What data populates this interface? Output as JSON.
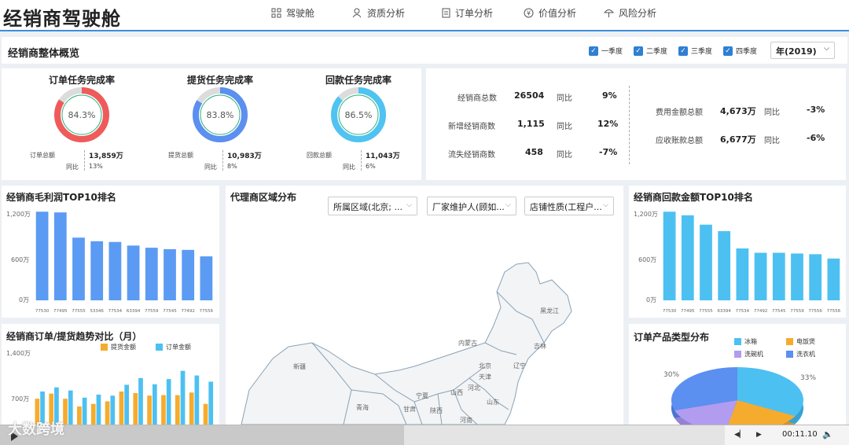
{
  "header": {
    "title": "经销商驾驶舱",
    "nav": [
      {
        "label": "驾驶舱",
        "icon": "grid-icon"
      },
      {
        "label": "资质分析",
        "icon": "people-icon"
      },
      {
        "label": "订单分析",
        "icon": "document-icon"
      },
      {
        "label": "价值分析",
        "icon": "yen-icon"
      },
      {
        "label": "风险分析",
        "icon": "umbrella-icon"
      }
    ]
  },
  "overview": {
    "title": "经销商整体概览",
    "quarters": [
      "一季度",
      "二季度",
      "三季度",
      "四季度"
    ],
    "year": "年(2019)"
  },
  "kpis": [
    {
      "title": "订单任务完成率",
      "pct": "84.3%",
      "fraction": 0.843,
      "color": "#ef5b5b",
      "amount_label": "订单总额",
      "amount": "13,859万",
      "yoy_label": "同比",
      "yoy": "13%"
    },
    {
      "title": "提货任务完成率",
      "pct": "83.8%",
      "fraction": 0.838,
      "color": "#5b8ff0",
      "amount_label": "提货总额",
      "amount": "10,983万",
      "yoy_label": "同比",
      "yoy": "8%"
    },
    {
      "title": "回款任务完成率",
      "pct": "86.5%",
      "fraction": 0.865,
      "color": "#4fc3f2",
      "amount_label": "回款总额",
      "amount": "11,043万",
      "yoy_label": "同比",
      "yoy": "6%"
    }
  ],
  "stats_left": [
    {
      "label": "经销商总数",
      "value": "26504",
      "yoy_label": "同比",
      "yoy": "9%"
    },
    {
      "label": "新增经销商数",
      "value": "1,115",
      "yoy_label": "同比",
      "yoy": "12%"
    },
    {
      "label": "流失经销商数",
      "value": "458",
      "yoy_label": "同比",
      "yoy": "-7%"
    }
  ],
  "stats_right": [
    {
      "label": "费用金额总额",
      "value": "4,673万",
      "yoy_label": "同比",
      "yoy": "-3%"
    },
    {
      "label": "应收账款总额",
      "value": "6,677万",
      "yoy_label": "同比",
      "yoy": "-6%"
    }
  ],
  "profit_chart": {
    "title": "经销商毛利润TOP10排名",
    "yticks": [
      "1,200万",
      "600万",
      "0万"
    ]
  },
  "region_map": {
    "title": "代理商区域分布",
    "filters": [
      "所属区域(北京; ...",
      "厂家维护人(顾如...",
      "店铺性质(工程户..."
    ],
    "labels": [
      "黑龙江",
      "吉林",
      "内蒙古",
      "辽宁",
      "新疆",
      "北京",
      "天津",
      "河北",
      "山西",
      "宁夏",
      "甘肃",
      "青海",
      "陕西",
      "山东",
      "河南"
    ]
  },
  "payment_chart": {
    "title": "经销商回款金额TOP10排名",
    "yticks": [
      "1,200万",
      "600万",
      "0万"
    ]
  },
  "trend_chart": {
    "title": "经销商订单/提货趋势对比（月）",
    "yticks": [
      "1,400万",
      "700万"
    ]
  },
  "pie_chart": {
    "title": "订单产品类型分布",
    "legend": [
      "冰箱",
      "电饭煲",
      "洗碗机",
      "洗衣机"
    ],
    "labels": [
      "30%",
      "33%"
    ]
  },
  "player": {
    "time": "00:11.10"
  },
  "watermark": "大数跨境",
  "colors": {
    "accent": "#3c8ee0",
    "bar_blue": "#5b9bf3",
    "bar_cyan": "#4dc0f2",
    "bar_orange": "#f5ac2e"
  },
  "chart_data": [
    {
      "type": "bar",
      "title": "经销商毛利润TOP10排名",
      "categories": [
        "77530",
        "77495",
        "77555",
        "53346",
        "77534",
        "63394",
        "77559",
        "77545",
        "77492",
        "77556"
      ],
      "values": [
        1230,
        1220,
        870,
        820,
        810,
        760,
        730,
        710,
        700,
        610
      ],
      "ylim": [
        0,
        1200
      ],
      "yunit": "万"
    },
    {
      "type": "bar",
      "title": "经销商回款金额TOP10排名",
      "categories": [
        "77530",
        "77495",
        "77555",
        "63394",
        "77534",
        "77492",
        "77545",
        "77559",
        "77556",
        "77556"
      ],
      "values": [
        1230,
        1180,
        1050,
        960,
        720,
        660,
        660,
        650,
        640,
        580
      ],
      "ylim": [
        0,
        1200
      ],
      "yunit": "万"
    },
    {
      "type": "bar",
      "title": "经销商订单/提货趋势对比（月）",
      "series": [
        {
          "name": "提货金额",
          "values": [
            500,
            600,
            500,
            350,
            400,
            450,
            640,
            610,
            560,
            570,
            570,
            620,
            400
          ]
        },
        {
          "name": "订单金额",
          "values": [
            640,
            720,
            660,
            520,
            580,
            560,
            770,
            900,
            780,
            880,
            1040,
            950,
            830
          ]
        }
      ],
      "yticks_labels": [
        "1,400万",
        "700万"
      ],
      "ylim": [
        0,
        1400
      ],
      "yunit": "万"
    },
    {
      "type": "pie",
      "title": "订单产品类型分布",
      "categories": [
        "冰箱",
        "电饭煲",
        "洗碗机",
        "洗衣机"
      ],
      "values": [
        33,
        20,
        17,
        30
      ],
      "visible_labels": [
        "30%",
        "33%"
      ]
    }
  ]
}
